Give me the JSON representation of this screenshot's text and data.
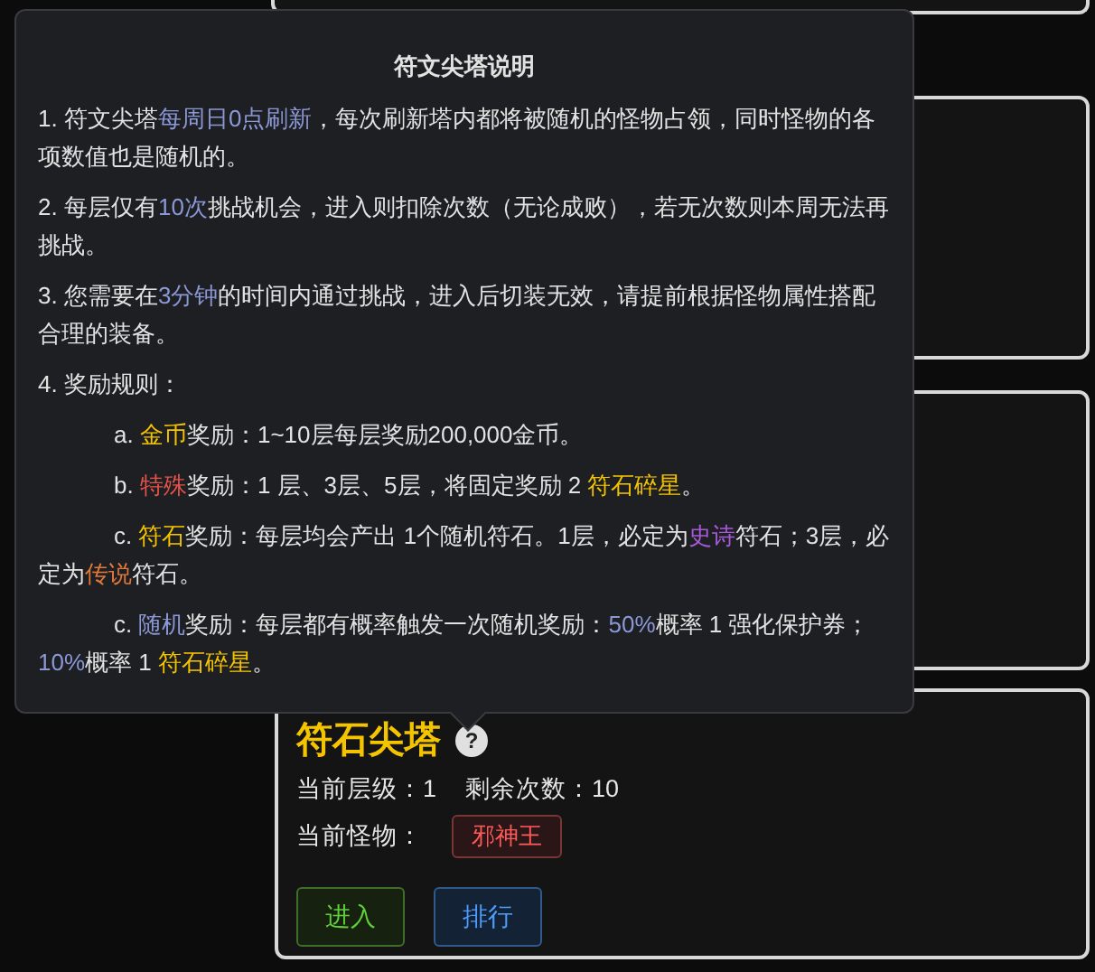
{
  "tooltip": {
    "title": "符文尖塔说明",
    "rules": [
      {
        "kind": "main",
        "parts": [
          {
            "text": "1. 符文尖塔"
          },
          {
            "text": "每周日0点刷新",
            "color": "#8b98d6"
          },
          {
            "text": "，每次刷新塔内都将被随机的怪物占领，同时怪物的各项数值也是随机的。"
          }
        ]
      },
      {
        "kind": "main",
        "parts": [
          {
            "text": "2. 每层仅有"
          },
          {
            "text": "10次",
            "color": "#8b98d6"
          },
          {
            "text": "挑战机会，进入则扣除次数（无论成败），若无次数则本周无法再挑战。"
          }
        ]
      },
      {
        "kind": "main",
        "parts": [
          {
            "text": "3. 您需要在"
          },
          {
            "text": "3分钟",
            "color": "#8b98d6"
          },
          {
            "text": "的时间内通过挑战，进入后切装无效，请提前根据怪物属性搭配合理的装备。"
          }
        ]
      },
      {
        "kind": "main",
        "parts": [
          {
            "text": "4. 奖励规则："
          }
        ]
      },
      {
        "kind": "sub",
        "parts": [
          {
            "text": "a. "
          },
          {
            "text": "金币",
            "color": "#f5c400"
          },
          {
            "text": "奖励：1~10层每层奖励200,000金币。"
          }
        ]
      },
      {
        "kind": "sub",
        "parts": [
          {
            "text": "b. "
          },
          {
            "text": "特殊",
            "color": "#e5534b"
          },
          {
            "text": "奖励：1 层、3层、5层，将固定奖励 2 "
          },
          {
            "text": "符石碎星",
            "color": "#f5c400"
          },
          {
            "text": "。"
          }
        ]
      },
      {
        "kind": "sub",
        "parts": [
          {
            "text": "c. "
          },
          {
            "text": "符石",
            "color": "#f5c400"
          },
          {
            "text": "奖励：每层均会产出 1个随机符石。1层，必定为"
          },
          {
            "text": "史诗",
            "color": "#a65ad8"
          },
          {
            "text": "符石；3层，必定为"
          },
          {
            "text": "传说",
            "color": "#e0793a"
          },
          {
            "text": "符石。"
          }
        ]
      },
      {
        "kind": "sub",
        "parts": [
          {
            "text": "c. "
          },
          {
            "text": "随机",
            "color": "#8b98d6"
          },
          {
            "text": "奖励：每层都有概率触发一次随机奖励："
          },
          {
            "text": "50%",
            "color": "#8b98d6"
          },
          {
            "text": "概率 1 强化保护券；"
          },
          {
            "text": "10%",
            "color": "#8b98d6"
          },
          {
            "text": "概率 1 "
          },
          {
            "text": "符石碎星",
            "color": "#f5c400"
          },
          {
            "text": "。"
          }
        ]
      }
    ]
  },
  "tower_card": {
    "title": "符石尖塔",
    "help_icon": "?",
    "stats": [
      {
        "label": "当前层级：",
        "value": "1"
      },
      {
        "label": "剩余次数：",
        "value": "10"
      }
    ],
    "monster_label": "当前怪物：",
    "monster": "邪神王",
    "buttons": [
      {
        "label": "进入",
        "kind": "success"
      },
      {
        "label": "排行",
        "kind": "primary"
      }
    ]
  }
}
